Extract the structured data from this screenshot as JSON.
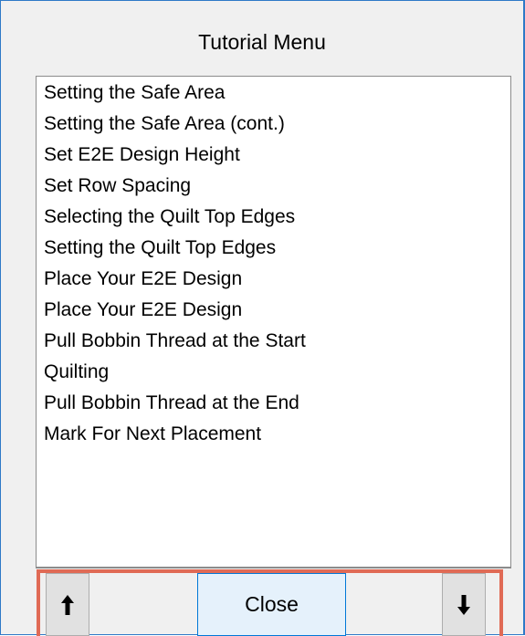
{
  "window": {
    "title": "Tutorial Menu"
  },
  "tutorial_list": {
    "items": [
      "Setting the Safe Area",
      "Setting the Safe Area (cont.)",
      "Set E2E Design Height",
      "Set Row Spacing",
      "Selecting the Quilt Top Edges",
      "Setting the Quilt Top Edges",
      "Place Your E2E Design",
      "Place Your E2E Design",
      "Pull Bobbin Thread at the Start",
      "Quilting",
      "Pull Bobbin Thread at the End",
      "Mark For Next Placement"
    ]
  },
  "buttons": {
    "up_icon": "arrow-up-icon",
    "close_label": "Close",
    "down_icon": "arrow-down-icon"
  },
  "colors": {
    "window_border": "#2e79c7",
    "highlight_border": "#e06a55",
    "close_button_bg": "#e5f1fb",
    "close_button_border": "#0078d7"
  }
}
